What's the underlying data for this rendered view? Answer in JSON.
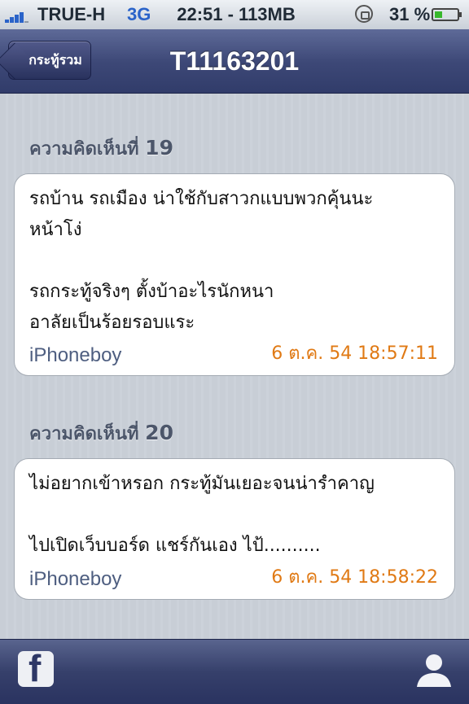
{
  "status_bar": {
    "carrier": "TRUE-H",
    "network": "3G",
    "center": "22:51 - 113MB",
    "battery": "31 %",
    "battery_level": 0.31
  },
  "nav": {
    "back_label": "กระทู้รวม",
    "title": "T11163201"
  },
  "comments": [
    {
      "header_label": "ความคิดเห็นที่",
      "number": "19",
      "text": "รถบ้าน รถเมือง น่าใช้กับสาวกแบบพวกคุ้นนะ\nหน้าโง่\n\nรถกระทู้จริงๆ ตั้งบ้าอะไรนักหนา\nอาลัยเป็นร้อยรอบแระ",
      "user": "iPhoneboy",
      "time": "6 ต.ค. 54 18:57:11"
    },
    {
      "header_label": "ความคิดเห็นที่",
      "number": "20",
      "text": "ไม่อยากเข้าหรอก กระทู้มันเยอะจนน่ารำคาญ\n\nไปเปิดเว็บบอร์ด แชร์กันเอง ไป้..........",
      "user": "iPhoneboy",
      "time": "6 ต.ค. 54 18:58:22"
    }
  ],
  "tab_bar": {
    "left_icon": "facebook-icon",
    "right_icon": "user-icon"
  },
  "colors": {
    "nav_bar": "#3d4877",
    "timestamp": "#e07a15",
    "username": "#4e5e80"
  }
}
